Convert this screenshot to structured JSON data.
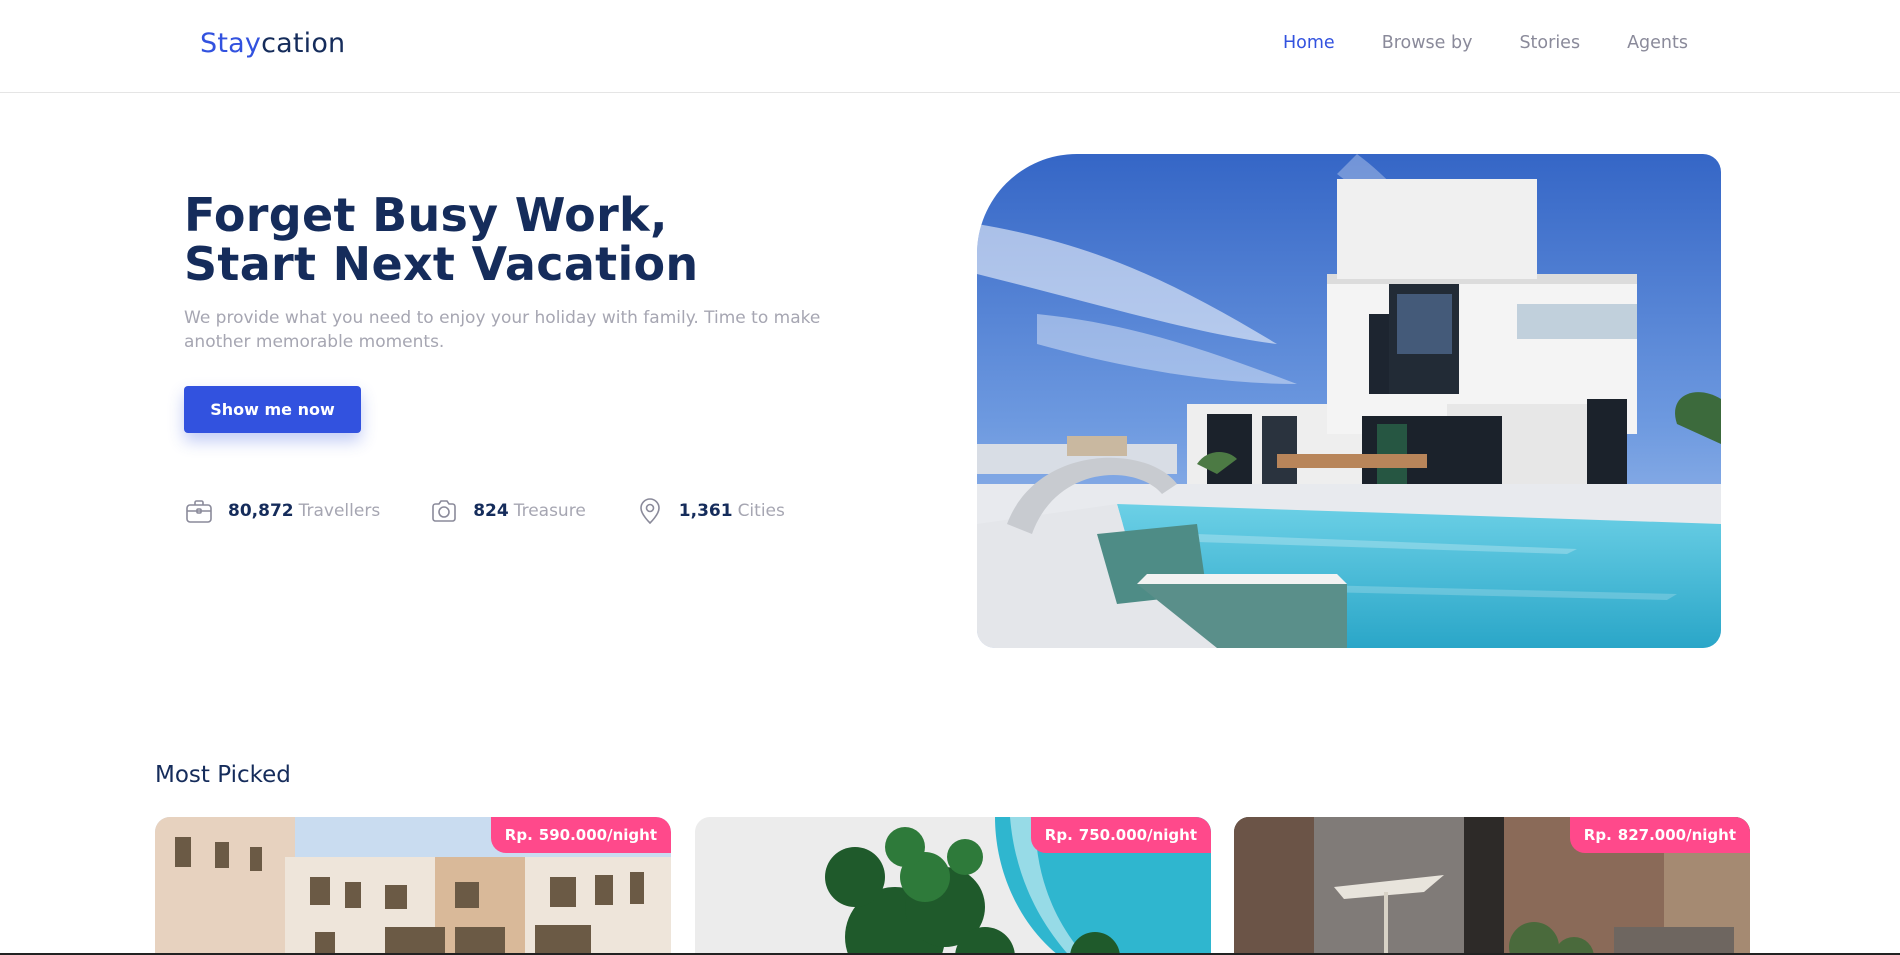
{
  "header": {
    "logo_part1": "Stay",
    "logo_part2": "cation",
    "nav": [
      "Home",
      "Browse by",
      "Stories",
      "Agents"
    ],
    "active_nav": "Home"
  },
  "hero": {
    "title_line1": "Forget Busy Work,",
    "title_line2": "Start Next Vacation",
    "subtitle": "We provide what you need to enjoy your holiday with family. Time to make another memorable moments.",
    "cta_label": "Show me now",
    "stats": [
      {
        "icon": "suitcase-icon",
        "value": "80,872",
        "label": "Travellers"
      },
      {
        "icon": "camera-icon",
        "value": "824",
        "label": "Treasure"
      },
      {
        "icon": "map-pin-icon",
        "value": "1,361",
        "label": "Cities"
      }
    ]
  },
  "most_picked": {
    "title": "Most Picked",
    "cards": [
      {
        "currency": "Rp.",
        "price": "590.000/night"
      },
      {
        "currency": "Rp.",
        "price": "750.000/night"
      },
      {
        "currency": "Rp.",
        "price": "827.000/night"
      }
    ]
  },
  "colors": {
    "primary": "#3252df",
    "navy": "#152c5b",
    "gray": "#a6a6b2",
    "pink": "#ff498b"
  }
}
